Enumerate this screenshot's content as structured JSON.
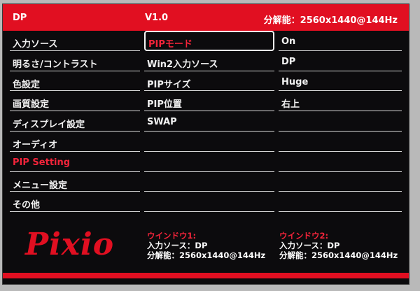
{
  "topbar": {
    "input": "DP",
    "version": "V1.0",
    "resolution": "分解能：2560x1440@144Hz"
  },
  "menu": {
    "items": [
      {
        "label": "入力ソース"
      },
      {
        "label": "明るさ/コントラスト"
      },
      {
        "label": "色設定"
      },
      {
        "label": "画質設定"
      },
      {
        "label": "ディスプレイ設定"
      },
      {
        "label": "オーディオ"
      },
      {
        "label": "PIP Setting"
      },
      {
        "label": "メニュー設定"
      },
      {
        "label": "その他"
      }
    ],
    "active_index": 6
  },
  "submenu": {
    "items": [
      {
        "label": "PIPモード"
      },
      {
        "label": "Win2入力ソース"
      },
      {
        "label": "PIPサイズ"
      },
      {
        "label": "PIP位置"
      },
      {
        "label": "SWAP"
      },
      {
        "label": ""
      },
      {
        "label": ""
      },
      {
        "label": ""
      },
      {
        "label": ""
      }
    ],
    "selected_index": 0
  },
  "values": {
    "items": [
      {
        "label": "On"
      },
      {
        "label": "DP"
      },
      {
        "label": "Huge"
      },
      {
        "label": "右上"
      },
      {
        "label": ""
      },
      {
        "label": ""
      },
      {
        "label": ""
      },
      {
        "label": ""
      },
      {
        "label": ""
      }
    ]
  },
  "footer": {
    "logo": "Pixio",
    "window1": {
      "title": "ウインドウ1:",
      "input": "入力ソース：DP",
      "resolution": "分解能：2560x1440@144Hz"
    },
    "window2": {
      "title": "ウインドウ2:",
      "input": "入力ソース：DP",
      "resolution": "分解能：2560x1440@144Hz"
    }
  },
  "colors": {
    "accent": "#e10f21",
    "background": "#0c0b0d",
    "highlight_text": "#f3243a"
  }
}
